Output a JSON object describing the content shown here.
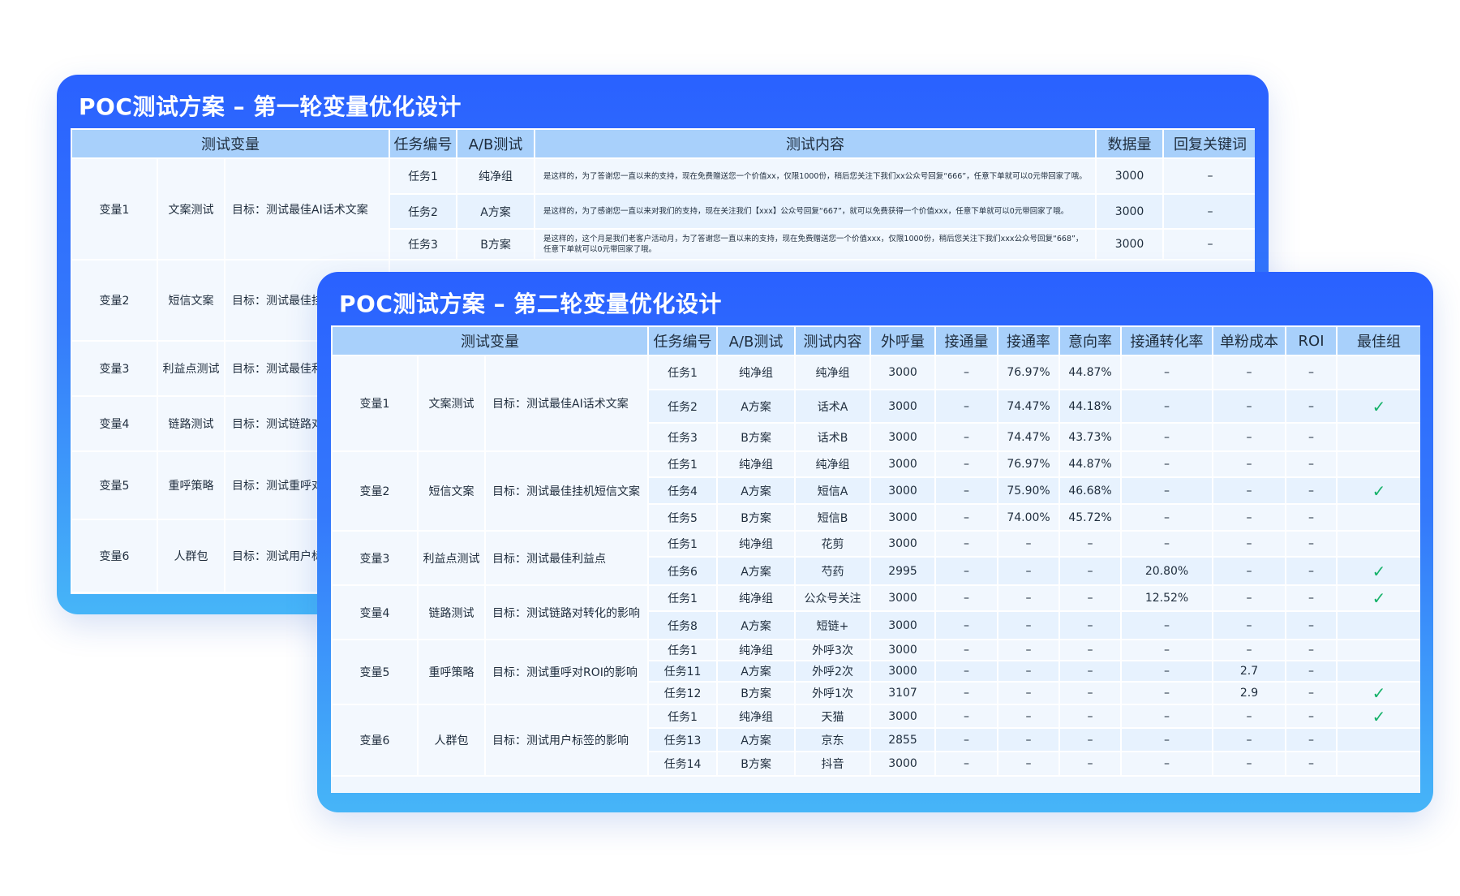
{
  "table1": {
    "title": "POC测试方案 – 第一轮变量优化设计",
    "headers": [
      "测试变量",
      "任务编号",
      "A/B测试",
      "测试内容",
      "数据量",
      "回复关键词"
    ],
    "group1": {
      "variable": "变量1",
      "name": "文案测试",
      "goal": "目标：测试最佳AI话术文案",
      "rows": [
        {
          "task": "任务1",
          "ab": "纯净组",
          "content": "是这样的，为了答谢您一直以来的支持，现在免费赠送您一个价值xx，仅限1000份，稍后您关注下我们xx公众号回复“666”，任意下单就可以0元带回家了哦。",
          "count": "3000",
          "kw": "–"
        },
        {
          "task": "任务2",
          "ab": "A方案",
          "content": "是这样的，为了感谢您一直以来对我们的支持，现在关注我们【xxx】公众号回复“667”，就可以免费获得一个价值xxx，任意下单就可以0元带回家了哦。",
          "count": "3000",
          "kw": "–"
        },
        {
          "task": "任务3",
          "ab": "B方案",
          "content": "是这样的，这个月是我们老客户活动月，为了答谢您一直以来的支持，现在免费赠送您一个价值xxx，仅限1000份，稍后您关注下我们xxx公众号回复“668”，任意下单就可以0元带回家了哦。",
          "count": "3000",
          "kw": "–"
        }
      ]
    },
    "others": [
      {
        "variable": "变量2",
        "name": "短信文案",
        "goal": "目标：测试最佳挂"
      },
      {
        "variable": "变量3",
        "name": "利益点测试",
        "goal": "目标：测试最佳利"
      },
      {
        "variable": "变量4",
        "name": "链路测试",
        "goal": "目标：测试链路对"
      },
      {
        "variable": "变量5",
        "name": "重呼策略",
        "goal": "目标：测试重呼对"
      },
      {
        "variable": "变量6",
        "name": "人群包",
        "goal": "目标：测试用户标"
      }
    ]
  },
  "table2": {
    "title": "POC测试方案 – 第二轮变量优化设计",
    "headers": [
      "测试变量",
      "任务编号",
      "A/B测试",
      "测试内容",
      "外呼量",
      "接通量",
      "接通率",
      "意向率",
      "接通转化率",
      "单粉成本",
      "ROI",
      "最佳组"
    ],
    "groups": [
      {
        "variable": "变量1",
        "name": "文案测试",
        "goal": "目标：测试最佳AI话术文案",
        "rows": [
          {
            "task": "任务1",
            "ab": "纯净组",
            "content": "纯净组",
            "calls": "3000",
            "conn": "–",
            "rate": "76.97%",
            "intent": "44.87%",
            "conv": "–",
            "cost": "–",
            "roi": "–",
            "best": ""
          },
          {
            "task": "任务2",
            "ab": "A方案",
            "content": "话术A",
            "calls": "3000",
            "conn": "–",
            "rate": "74.47%",
            "intent": "44.18%",
            "conv": "–",
            "cost": "–",
            "roi": "–",
            "best": "✓"
          },
          {
            "task": "任务3",
            "ab": "B方案",
            "content": "话术B",
            "calls": "3000",
            "conn": "–",
            "rate": "74.47%",
            "intent": "43.73%",
            "conv": "–",
            "cost": "–",
            "roi": "–",
            "best": ""
          }
        ]
      },
      {
        "variable": "变量2",
        "name": "短信文案",
        "goal": "目标：测试最佳挂机短信文案",
        "rows": [
          {
            "task": "任务1",
            "ab": "纯净组",
            "content": "纯净组",
            "calls": "3000",
            "conn": "–",
            "rate": "76.97%",
            "intent": "44.87%",
            "conv": "–",
            "cost": "–",
            "roi": "–",
            "best": ""
          },
          {
            "task": "任务4",
            "ab": "A方案",
            "content": "短信A",
            "calls": "3000",
            "conn": "–",
            "rate": "75.90%",
            "intent": "46.68%",
            "conv": "–",
            "cost": "–",
            "roi": "–",
            "best": "✓"
          },
          {
            "task": "任务5",
            "ab": "B方案",
            "content": "短信B",
            "calls": "3000",
            "conn": "–",
            "rate": "74.00%",
            "intent": "45.72%",
            "conv": "–",
            "cost": "–",
            "roi": "–",
            "best": ""
          }
        ]
      },
      {
        "variable": "变量3",
        "name": "利益点测试",
        "goal": "目标：测试最佳利益点",
        "rows": [
          {
            "task": "任务1",
            "ab": "纯净组",
            "content": "花剪",
            "calls": "3000",
            "conn": "–",
            "rate": "–",
            "intent": "–",
            "conv": "–",
            "cost": "–",
            "roi": "–",
            "best": ""
          },
          {
            "task": "任务6",
            "ab": "A方案",
            "content": "芍药",
            "calls": "2995",
            "conn": "–",
            "rate": "–",
            "intent": "–",
            "conv": "20.80%",
            "cost": "–",
            "roi": "–",
            "best": "✓"
          }
        ]
      },
      {
        "variable": "变量4",
        "name": "链路测试",
        "goal": "目标：测试链路对转化的影响",
        "rows": [
          {
            "task": "任务1",
            "ab": "纯净组",
            "content": "公众号关注",
            "calls": "3000",
            "conn": "–",
            "rate": "–",
            "intent": "–",
            "conv": "12.52%",
            "cost": "–",
            "roi": "–",
            "best": "✓"
          },
          {
            "task": "任务8",
            "ab": "A方案",
            "content": "短链+",
            "calls": "3000",
            "conn": "–",
            "rate": "–",
            "intent": "–",
            "conv": "–",
            "cost": "–",
            "roi": "–",
            "best": ""
          }
        ]
      },
      {
        "variable": "变量5",
        "name": "重呼策略",
        "goal": "目标：测试重呼对ROI的影响",
        "rows": [
          {
            "task": "任务1",
            "ab": "纯净组",
            "content": "外呼3次",
            "calls": "3000",
            "conn": "–",
            "rate": "–",
            "intent": "–",
            "conv": "–",
            "cost": "–",
            "roi": "–",
            "best": ""
          },
          {
            "task": "任务11",
            "ab": "A方案",
            "content": "外呼2次",
            "calls": "3000",
            "conn": "–",
            "rate": "–",
            "intent": "–",
            "conv": "–",
            "cost": "2.7",
            "roi": "–",
            "best": ""
          },
          {
            "task": "任务12",
            "ab": "B方案",
            "content": "外呼1次",
            "calls": "3107",
            "conn": "–",
            "rate": "–",
            "intent": "–",
            "conv": "–",
            "cost": "2.9",
            "roi": "–",
            "best": "✓"
          }
        ]
      },
      {
        "variable": "变量6",
        "name": "人群包",
        "goal": "目标：测试用户标签的影响",
        "rows": [
          {
            "task": "任务1",
            "ab": "纯净组",
            "content": "天猫",
            "calls": "3000",
            "conn": "–",
            "rate": "–",
            "intent": "–",
            "conv": "–",
            "cost": "–",
            "roi": "–",
            "best": "✓"
          },
          {
            "task": "任务13",
            "ab": "A方案",
            "content": "京东",
            "calls": "2855",
            "conn": "–",
            "rate": "–",
            "intent": "–",
            "conv": "–",
            "cost": "–",
            "roi": "–",
            "best": ""
          },
          {
            "task": "任务14",
            "ab": "B方案",
            "content": "抖音",
            "calls": "3000",
            "conn": "–",
            "rate": "–",
            "intent": "–",
            "conv": "–",
            "cost": "–",
            "roi": "–",
            "best": ""
          }
        ]
      }
    ]
  },
  "colors": {
    "panel_top": "#2a61ff",
    "panel_bottom": "#46b5f8",
    "header_bg": "#a8d0fb",
    "check": "#16b26a"
  }
}
